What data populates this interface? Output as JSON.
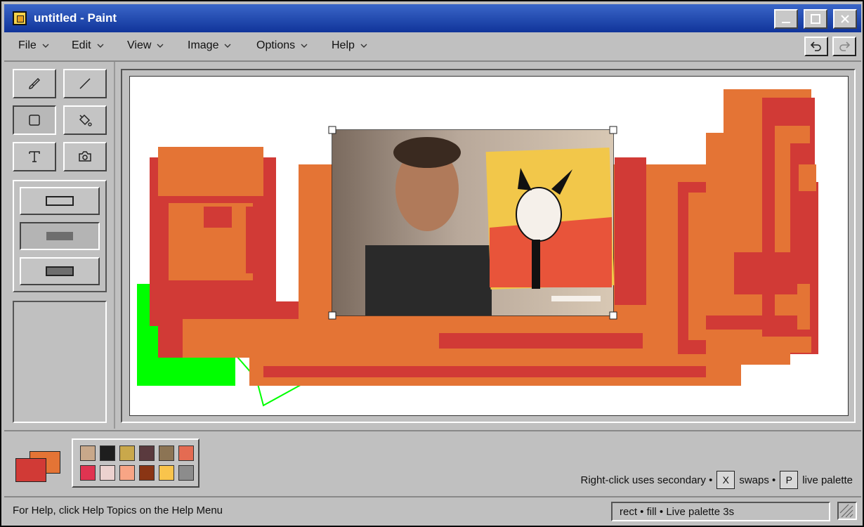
{
  "window": {
    "title": "untitled - Paint",
    "title_color": "#10349a",
    "controls": [
      "minimize-icon",
      "maximize-icon",
      "close-icon"
    ]
  },
  "menu": {
    "items": [
      "File",
      "Edit",
      "View",
      "Image",
      "Options",
      "Help"
    ],
    "undo_icon": "undo-icon",
    "redo_icon": "redo-icon"
  },
  "toolbox": {
    "tools": [
      {
        "name": "brush",
        "icon": "brush-icon",
        "active": false
      },
      {
        "name": "line",
        "icon": "line-icon",
        "active": false
      },
      {
        "name": "rectangle",
        "icon": "rectangle-icon",
        "active": true
      },
      {
        "name": "fill",
        "icon": "paint-bucket-icon",
        "active": false
      },
      {
        "name": "text",
        "icon": "text-icon",
        "active": false
      },
      {
        "name": "camera",
        "icon": "camera-icon",
        "active": false
      }
    ],
    "fill_styles": [
      "outline",
      "fill",
      "outline-and-fill"
    ],
    "active_fill_style": "fill"
  },
  "colors": {
    "primary": "#d13a36",
    "secondary": "#e47435",
    "palette": [
      "#c8a88a",
      "#1e1e1e",
      "#c9a84b",
      "#5a3a3e",
      "#8c7454",
      "#e46b52",
      "#e03451",
      "#ecd2cf",
      "#f8a585",
      "#8a3514",
      "#f9c44c",
      "#8c8c8c"
    ]
  },
  "hint": {
    "prefix": "Right-click uses secondary •",
    "key_swap": "X",
    "swap_text": "swaps •",
    "key_palette": "P",
    "palette_text": "live palette"
  },
  "status": {
    "help_text": "For Help, click Help Topics on the Help Menu",
    "mode_text": "rect • fill • Live palette 3s"
  }
}
